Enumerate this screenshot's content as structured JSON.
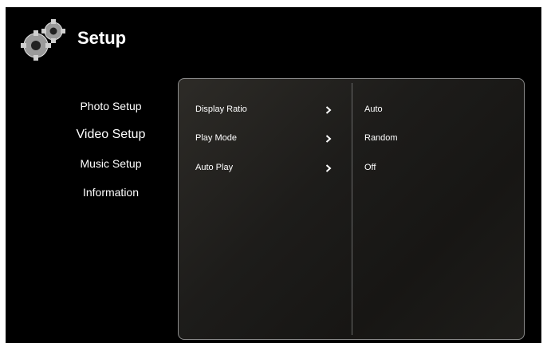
{
  "header": {
    "title": "Setup",
    "icon": "gears-icon"
  },
  "nav": {
    "items": [
      {
        "label": "Photo Setup",
        "active": false
      },
      {
        "label": "Video Setup",
        "active": true
      },
      {
        "label": "Music Setup",
        "active": false
      },
      {
        "label": "Information",
        "active": false
      }
    ]
  },
  "settings": {
    "rows": [
      {
        "label": "Display Ratio",
        "value": "Auto",
        "icon": "chevron-right-icon"
      },
      {
        "label": "Play Mode",
        "value": "Random",
        "icon": "chevron-right-icon"
      },
      {
        "label": "Auto Play",
        "value": "Off",
        "icon": "chevron-right-icon"
      }
    ]
  },
  "colors": {
    "accent": "#a4231f",
    "background": "#000000",
    "text": "#ffffff"
  }
}
